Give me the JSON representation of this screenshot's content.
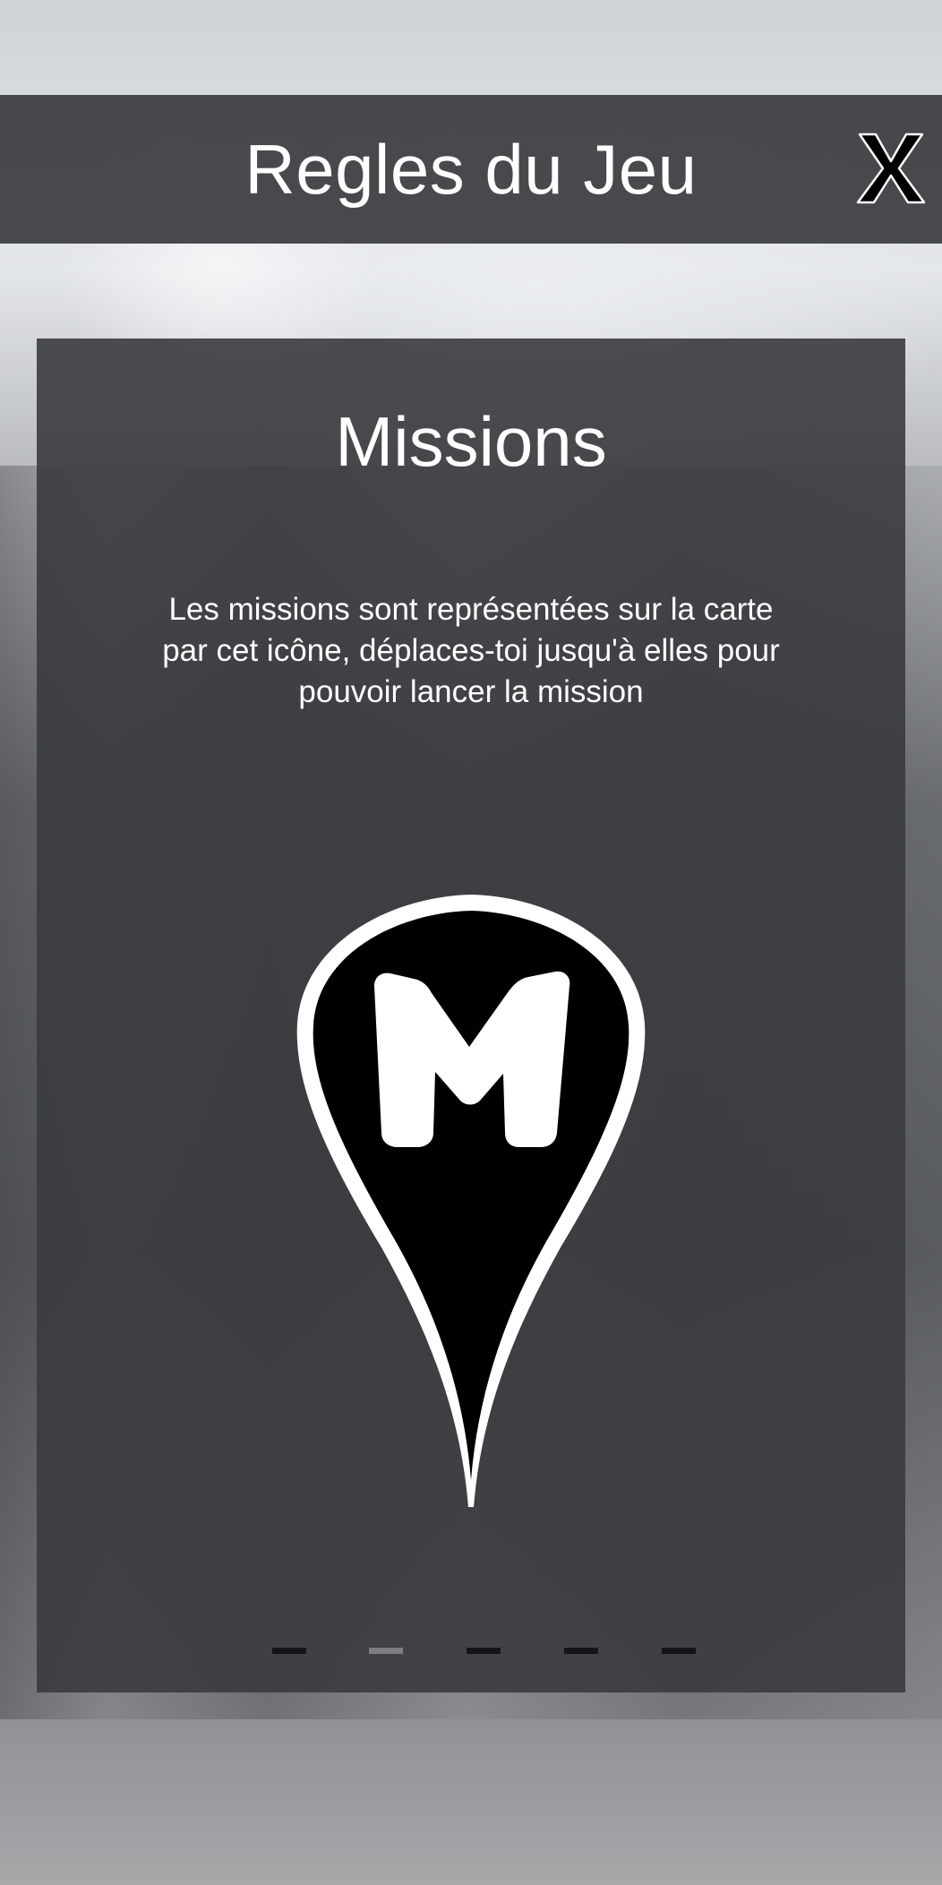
{
  "header": {
    "title": "Regles du Jeu",
    "close_label": "X"
  },
  "card": {
    "title": "Missions",
    "text": "Les missions sont représentées sur la carte par cet icône, déplaces-toi jusqu'à elles pour pouvoir lancer la mission",
    "icon": "mission-marker-icon"
  },
  "pager": {
    "count": 5,
    "active_index": 1
  },
  "colors": {
    "header_bg": "#3e3f42",
    "card_bg": "#3a3b3e",
    "text": "#ffffff",
    "dot": "#151517",
    "dot_active": "#7d7e82"
  }
}
